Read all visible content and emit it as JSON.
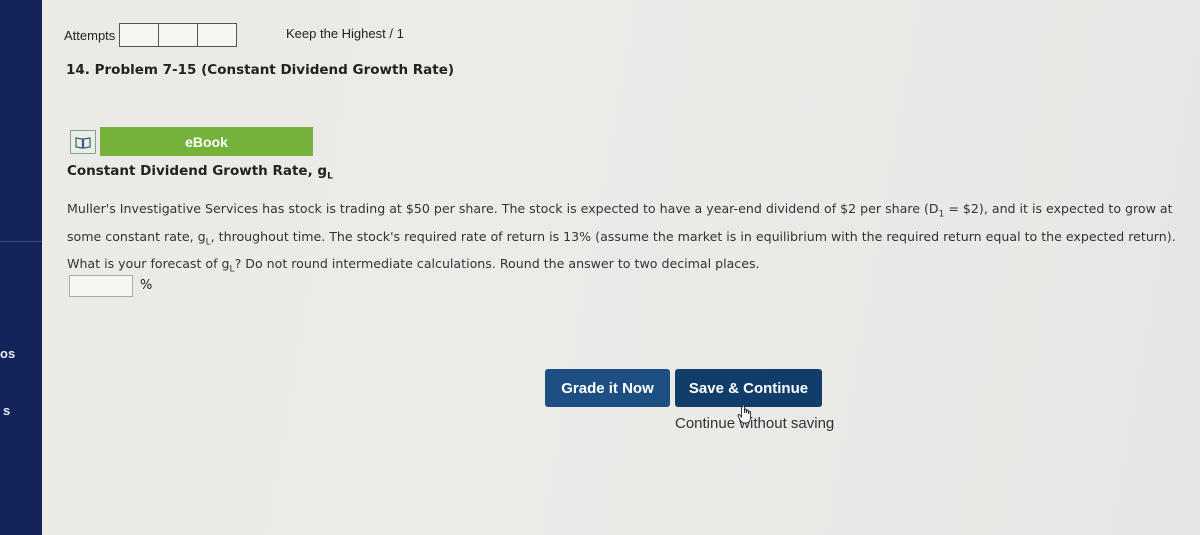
{
  "sidebar": {
    "labels": [
      "os",
      "s"
    ]
  },
  "header": {
    "attempts_label": "Attempts",
    "keep_highest": "Keep the Highest / 1"
  },
  "problem": {
    "title": "14. Problem 7-15 (Constant Dividend Growth Rate)",
    "ebook_label": "eBook",
    "heading": "Constant Dividend Growth Rate, g",
    "heading_sub": "L",
    "text_1": "Muller's Investigative Services has stock is trading at $50 per share. The stock is expected to have a year-end dividend of $2 per share (D",
    "text_sub1": "1",
    "text_2": " = $2), and it is expected to grow at some constant rate, g",
    "text_subL1": "L",
    "text_3": ", throughout time. The stock's required rate of return is 13% (assume the market is in equilibrium with the required return equal to the expected return). What is your forecast of g",
    "text_subL2": "L",
    "text_4": "? Do not round intermediate calculations. Round the answer to two decimal places.",
    "answer_value": "",
    "unit": "%"
  },
  "actions": {
    "grade_label": "Grade it Now",
    "save_label": "Save & Continue",
    "continue_label": "Continue without saving"
  },
  "colors": {
    "sidebar": "#14245a",
    "ebook": "#74b23a",
    "button": "#1d4f82"
  }
}
